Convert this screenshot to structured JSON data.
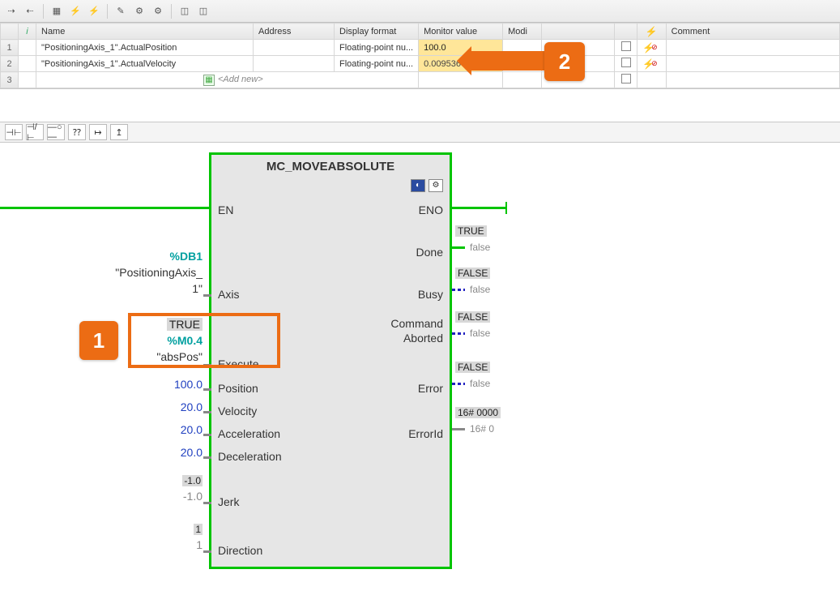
{
  "watch": {
    "headers": {
      "info": "i",
      "name": "Name",
      "address": "Address",
      "display": "Display format",
      "monitor": "Monitor value",
      "modify": "Modi",
      "bolt": "⚡",
      "comment": "Comment"
    },
    "rows": [
      {
        "num": "1",
        "name": "\"PositioningAxis_1\".ActualPosition",
        "display": "Floating-point nu...",
        "monitor": "100.0"
      },
      {
        "num": "2",
        "name": "\"PositioningAxis_1\".ActualVelocity",
        "display": "Floating-point nu...",
        "monitor": "0.009536743"
      }
    ],
    "addnew": "<Add new>",
    "addnew_num": "3"
  },
  "block": {
    "title": "MC_MOVEABSOLUTE",
    "en": "EN",
    "eno": "ENO",
    "inputs": {
      "axis": "Axis",
      "execute": "Execute",
      "position": "Position",
      "velocity": "Velocity",
      "acceleration": "Acceleration",
      "deceleration": "Deceleration",
      "jerk": "Jerk",
      "direction": "Direction"
    },
    "outputs": {
      "done": "Done",
      "busy": "Busy",
      "cmdA1": "Command",
      "cmdA2": "Aborted",
      "error": "Error",
      "errorId": "ErrorId"
    },
    "vals": {
      "axis_db": "%DB1",
      "axis_name1": "\"PositioningAxis_",
      "axis_name2": "1\"",
      "exec_state": "TRUE",
      "exec_addr": "%M0.4",
      "exec_name": "\"absPos\"",
      "position": "100.0",
      "velocity": "20.0",
      "acceleration": "20.0",
      "deceleration": "20.0",
      "jerk_badge": "-1.0",
      "jerk_grey": "-1.0",
      "dir_badge": "1",
      "dir_grey": "1"
    },
    "outvals": {
      "done_t": "TRUE",
      "done_f": "false",
      "busy_t": "FALSE",
      "busy_f": "false",
      "cmd_t": "FALSE",
      "cmd_f": "false",
      "err_t": "FALSE",
      "err_f": "false",
      "eid_t": "16# 0000",
      "eid_f": "16# 0"
    }
  },
  "callouts": {
    "one": "1",
    "two": "2"
  }
}
